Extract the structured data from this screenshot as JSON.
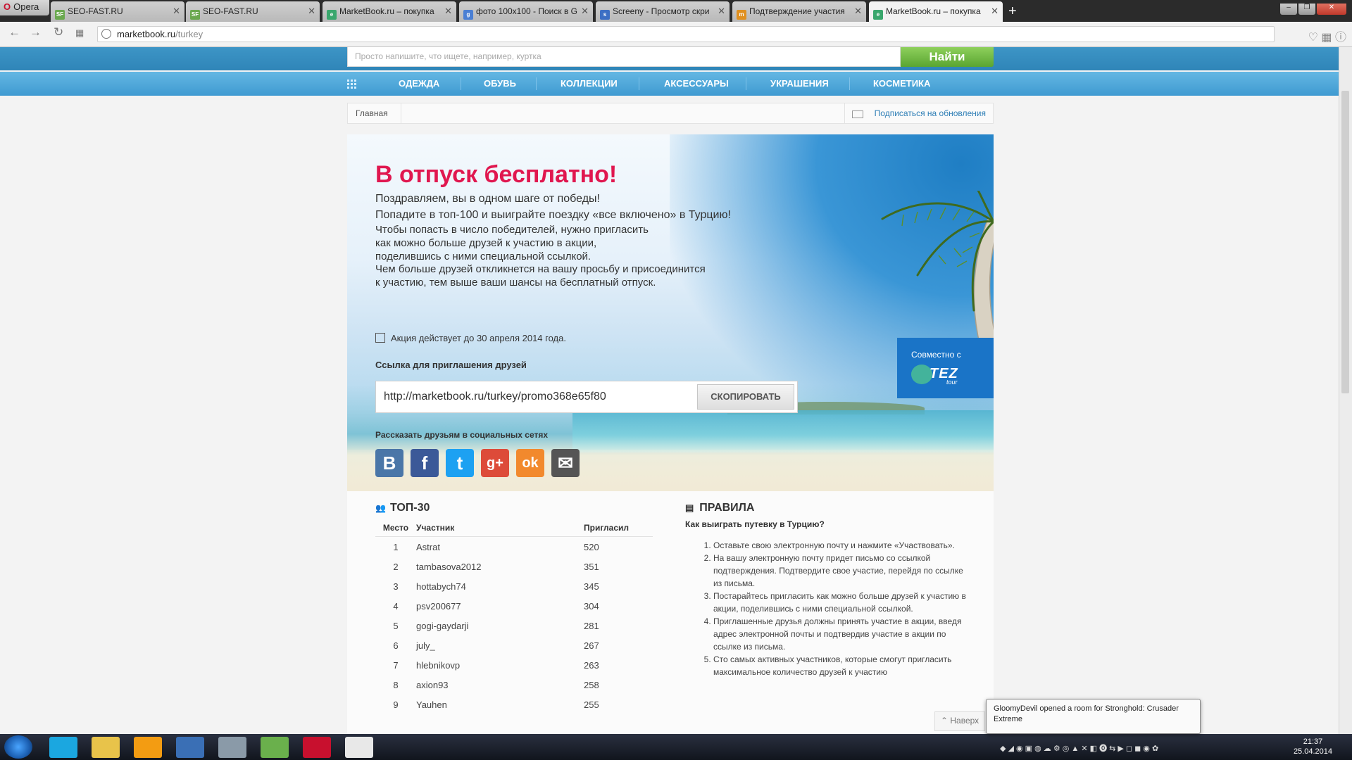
{
  "browser": {
    "menu_label": "Opera",
    "tabs": [
      {
        "title": "SEO-FAST.RU",
        "fav": "SF",
        "color": "#6aa84f"
      },
      {
        "title": "SEO-FAST.RU",
        "fav": "SF",
        "color": "#6aa84f"
      },
      {
        "title": "MarketBook.ru – покупка",
        "fav": "e",
        "color": "#3aa76d"
      },
      {
        "title": "фото 100x100 - Поиск в G",
        "fav": "g",
        "color": "#4a7fd4"
      },
      {
        "title": "Screeny - Просмотр скри",
        "fav": "s",
        "color": "#3d6fc4"
      },
      {
        "title": "Подтверждение участия",
        "fav": "m",
        "color": "#e09020"
      },
      {
        "title": "MarketBook.ru – покупка",
        "fav": "e",
        "color": "#3aa76d"
      }
    ],
    "url_host": "marketbook.ru",
    "url_path": "/turkey"
  },
  "site": {
    "search_placeholder": "Просто напишите, что ищете, например, куртка",
    "search_button": "Найти",
    "menu": [
      "Одежда",
      "Обувь",
      "Коллекции",
      "Аксессуары",
      "Украшения",
      "Косметика"
    ],
    "breadcrumb_home": "Главная",
    "subscribe": "Подписаться на обновления"
  },
  "promo": {
    "title": "В отпуск бесплатно!",
    "para1": [
      "Поздравляем, вы в одном шаге от победы!",
      "Попадите в топ-100 и выиграйте поездку «все включено» в Турцию!"
    ],
    "para2": [
      "Чтобы попасть в число победителей, нужно пригласить",
      "как можно больше друзей к участию в акции,",
      "поделившись с ними специальной ссылкой.",
      "Чем больше друзей откликнется на вашу просьбу и присоединится",
      "к участию, тем выше ваши шансы на бесплатный отпуск."
    ],
    "date": "Акция действует до 30 апреля 2014 года.",
    "link_label": "Ссылка для приглашения друзей",
    "link_value": "http://marketbook.ru/turkey/promo368e65f80",
    "copy_button": "СКОПИРОВАТЬ",
    "social_label": "Рассказать друзьям в социальных сетях",
    "social": [
      {
        "name": "vk",
        "glyph": "В",
        "color": "#4a76a8"
      },
      {
        "name": "facebook",
        "glyph": "f",
        "color": "#3b5998"
      },
      {
        "name": "twitter",
        "glyph": "t",
        "color": "#1da1f2"
      },
      {
        "name": "google-plus",
        "glyph": "g+",
        "color": "#dd4b39"
      },
      {
        "name": "odnoklassniki",
        "glyph": "ok",
        "color": "#f2892d"
      },
      {
        "name": "email",
        "glyph": "✉",
        "color": "#555555"
      }
    ],
    "partner_text": "Совместно с",
    "partner_logo_word": "TEZ",
    "partner_logo_sub": "tour"
  },
  "top": {
    "title": "ТОП-30",
    "headers": [
      "Место",
      "Участник",
      "Пригласил"
    ],
    "rows": [
      [
        "1",
        "Astrat",
        "520"
      ],
      [
        "2",
        "tambasova2012",
        "351"
      ],
      [
        "3",
        "hottabych74",
        "345"
      ],
      [
        "4",
        "psv200677",
        "304"
      ],
      [
        "5",
        "gogi-gaydarji",
        "281"
      ],
      [
        "6",
        "july_",
        "267"
      ],
      [
        "7",
        "hlebnikovp",
        "263"
      ],
      [
        "8",
        "axion93",
        "258"
      ],
      [
        "9",
        "Yauhen",
        "255"
      ]
    ]
  },
  "rules": {
    "title": "ПРАВИЛА",
    "question": "Как выиграть путевку в Турцию?",
    "items": [
      "Оставьте свою электронную почту и нажмите «Участвовать».",
      "На вашу электронную почту придет письмо со ссылкой подтверждения. Подтвердите свое участие, перейдя по ссылке из письма.",
      "Постарайтесь пригласить как можно больше друзей к участию в акции, поделившись с ними специальной ссылкой.",
      "Приглашенные друзья должны принять участие в акции, введя адрес электронной почты и подтвердив участие в акции по ссылке из письма.",
      "Сто самых активных участников, которые смогут пригласить максимальное количество друзей к участию"
    ],
    "back_to_top": "Наверх"
  },
  "taskbar": {
    "notification": "GloomyDevil opened a room for Stronghold: Crusader Extreme",
    "time": "21:37",
    "date": "25.04.2014"
  }
}
